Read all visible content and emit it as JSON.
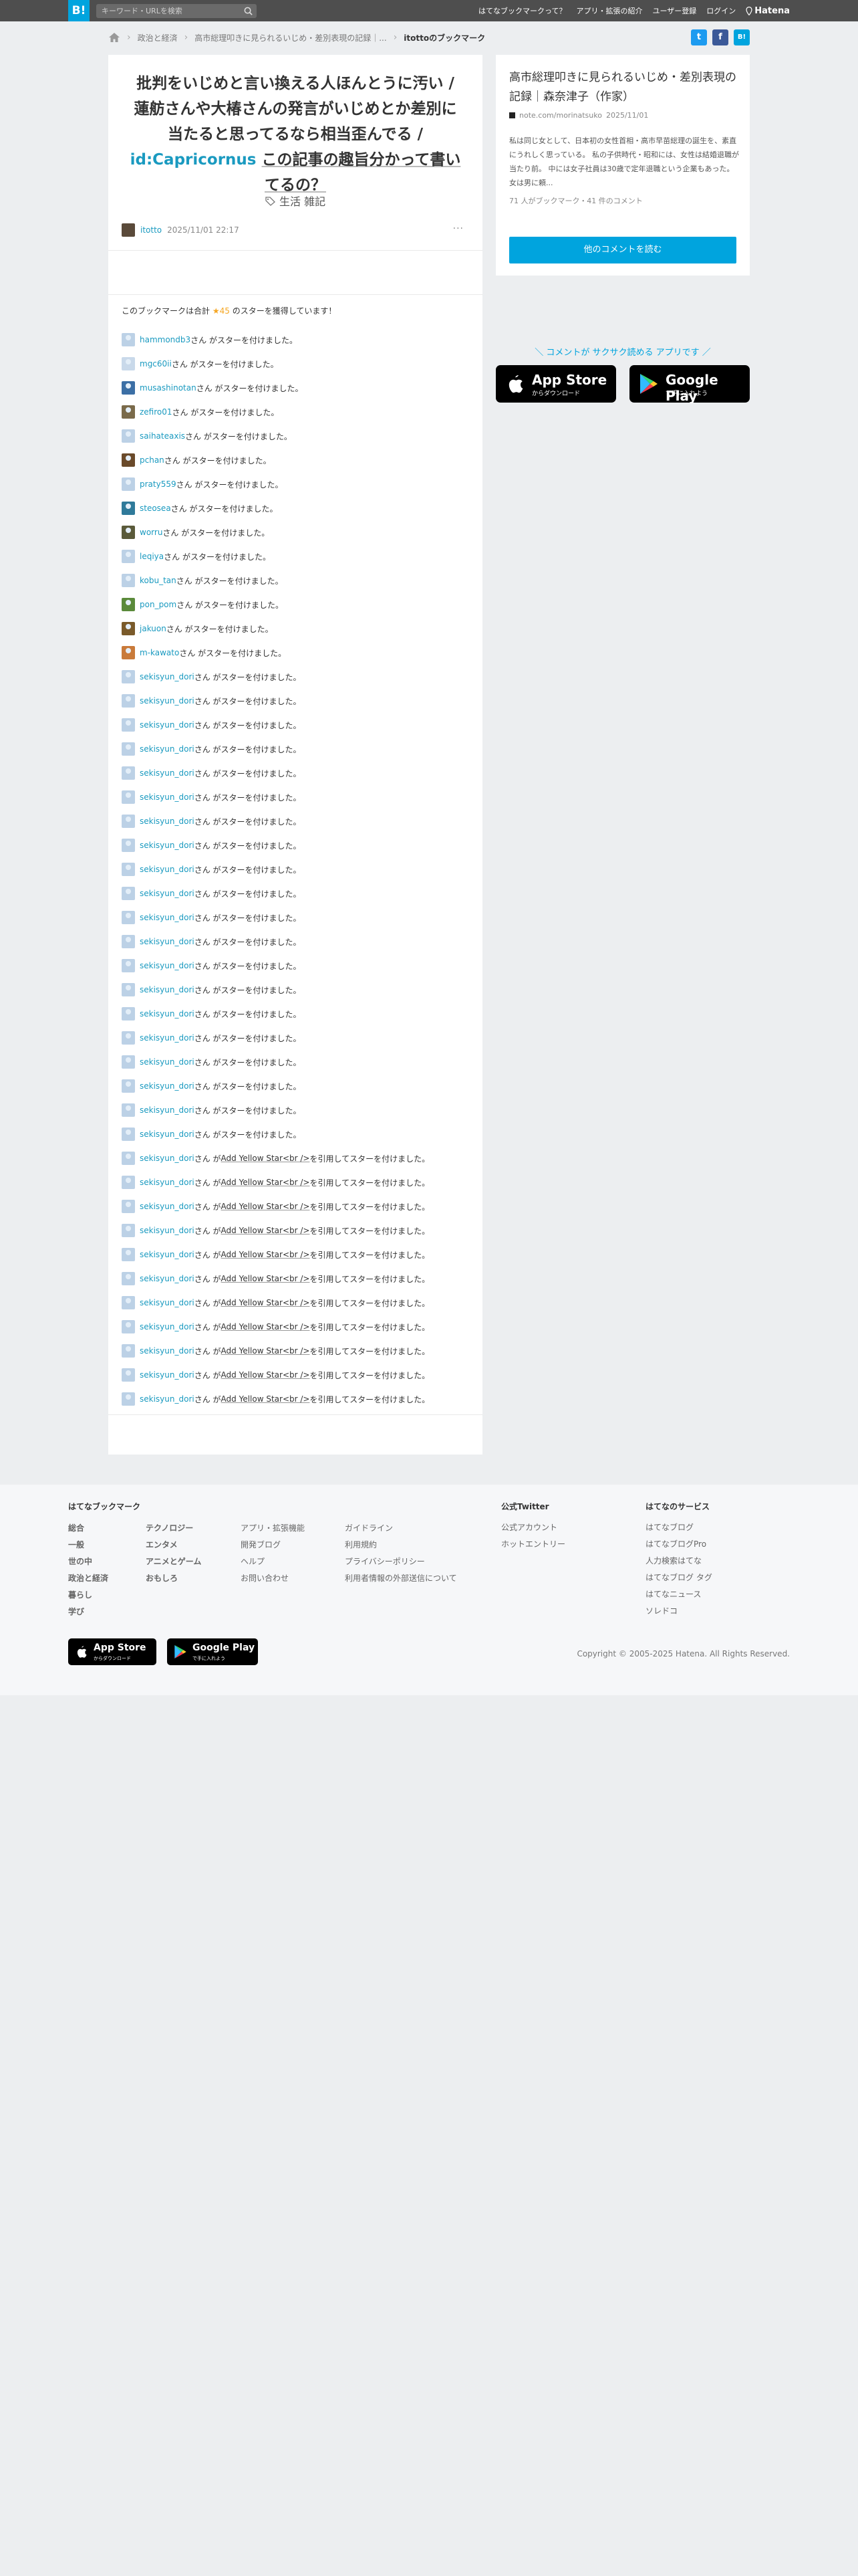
{
  "header": {
    "logo": "B!",
    "search_placeholder": "キーワード・URLを検索",
    "nav": [
      "はてなブックマークって？",
      "アプリ・拡張の紹介",
      "ユーザー登録",
      "ログイン"
    ],
    "brand": "Hatena"
  },
  "breadcrumb": {
    "items": [
      "政治と経済",
      "高市総理叩きに見られるいじめ・差別表現の記録｜..."
    ],
    "current": "itottoのブックマーク"
  },
  "share": {
    "twitter": "t",
    "facebook": "f",
    "hatena": "B!"
  },
  "entry": {
    "title_1": "批判をいじめと言い換える人ほんとうに汚い / 蓮舫さんや大椿さんの発言がいじめとか差別に当たると思ってるなら相当歪んでる / ",
    "title_link": "id:Capricornus",
    "title_2": "この記事の趣旨分かって書いてるの？",
    "tags": [
      "生活",
      "雑記"
    ],
    "user": "itotto",
    "timestamp": "2025/11/01 22:17",
    "more": "···"
  },
  "stars": {
    "summary_pre": "このブックマークは合計",
    "summary_count": "★45",
    "summary_post": "のスターを獲得しています！",
    "list": [
      {
        "name": "hammondb3",
        "text": "さん がスターを付けました。"
      },
      {
        "name": "mgc60ii",
        "text": "さん がスターを付けました。"
      },
      {
        "name": "musashinotan",
        "text": "さん がスターを付けました。"
      },
      {
        "name": "zefiro01",
        "text": "さん がスターを付けました。"
      },
      {
        "name": "saihateaxis",
        "text": "さん がスターを付けました。"
      },
      {
        "name": "pchan",
        "text": "さん がスターを付けました。"
      },
      {
        "name": "praty559",
        "text": "さん がスターを付けました。"
      },
      {
        "name": "steosea",
        "text": "さん がスターを付けました。"
      },
      {
        "name": "worru",
        "text": "さん がスターを付けました。"
      },
      {
        "name": "leqiya",
        "text": "さん がスターを付けました。"
      },
      {
        "name": "kobu_tan",
        "text": "さん がスターを付けました。"
      },
      {
        "name": "pon_pom",
        "text": "さん がスターを付けました。"
      },
      {
        "name": "jakuon",
        "text": "さん がスターを付けました。"
      },
      {
        "name": "m-kawato",
        "text": "さん がスターを付けました。"
      },
      {
        "name": "sekisyun_dori",
        "text": "さん がスターを付けました。"
      },
      {
        "name": "sekisyun_dori",
        "text": "さん がスターを付けました。"
      },
      {
        "name": "sekisyun_dori",
        "text": "さん がスターを付けました。"
      },
      {
        "name": "sekisyun_dori",
        "text": "さん がスターを付けました。"
      },
      {
        "name": "sekisyun_dori",
        "text": "さん がスターを付けました。"
      },
      {
        "name": "sekisyun_dori",
        "text": "さん がスターを付けました。"
      },
      {
        "name": "sekisyun_dori",
        "text": "さん がスターを付けました。"
      },
      {
        "name": "sekisyun_dori",
        "text": "さん がスターを付けました。"
      },
      {
        "name": "sekisyun_dori",
        "text": "さん がスターを付けました。"
      },
      {
        "name": "sekisyun_dori",
        "text": "さん がスターを付けました。"
      },
      {
        "name": "sekisyun_dori",
        "text": "さん がスターを付けました。"
      },
      {
        "name": "sekisyun_dori",
        "text": "さん がスターを付けました。"
      },
      {
        "name": "sekisyun_dori",
        "text": "さん がスターを付けました。"
      },
      {
        "name": "sekisyun_dori",
        "text": "さん がスターを付けました。"
      },
      {
        "name": "sekisyun_dori",
        "text": "さん がスターを付けました。"
      },
      {
        "name": "sekisyun_dori",
        "text": "さん がスターを付けました。"
      },
      {
        "name": "sekisyun_dori",
        "text": "さん がスターを付けました。"
      },
      {
        "name": "sekisyun_dori",
        "text": "さん がスターを付けました。"
      },
      {
        "name": "sekisyun_dori",
        "text": "さん がスターを付けました。"
      },
      {
        "name": "sekisyun_dori",
        "text": "さん がスターを付けました。"
      },
      {
        "name": "sekisyun_dori",
        "text": "さん が ",
        "quote": "Add Yellow Star<br />",
        "post": " を引用してスターを付けました。"
      },
      {
        "name": "sekisyun_dori",
        "text": "さん が ",
        "quote": "Add Yellow Star<br />",
        "post": " を引用してスターを付けました。"
      },
      {
        "name": "sekisyun_dori",
        "text": "さん が ",
        "quote": "Add Yellow Star<br />",
        "post": " を引用してスターを付けました。"
      },
      {
        "name": "sekisyun_dori",
        "text": "さん が ",
        "quote": "Add Yellow Star<br />",
        "post": " を引用してスターを付けました。"
      },
      {
        "name": "sekisyun_dori",
        "text": "さん が ",
        "quote": "Add Yellow Star<br />",
        "post": " を引用してスターを付けました。"
      },
      {
        "name": "sekisyun_dori",
        "text": "さん が ",
        "quote": "Add Yellow Star<br />",
        "post": " を引用してスターを付けました。"
      },
      {
        "name": "sekisyun_dori",
        "text": "さん が ",
        "quote": "Add Yellow Star<br />",
        "post": " を引用してスターを付けました。"
      },
      {
        "name": "sekisyun_dori",
        "text": "さん が ",
        "quote": "Add Yellow Star<br />",
        "post": " を引用してスターを付けました。"
      },
      {
        "name": "sekisyun_dori",
        "text": "さん が ",
        "quote": "Add Yellow Star<br />",
        "post": " を引用してスターを付けました。"
      },
      {
        "name": "sekisyun_dori",
        "text": "さん が ",
        "quote": "Add Yellow Star<br />",
        "post": " を引用してスターを付けました。"
      },
      {
        "name": "sekisyun_dori",
        "text": "さん が ",
        "quote": "Add Yellow Star<br />",
        "post": " を引用してスターを付けました。"
      }
    ]
  },
  "side": {
    "title": "高市総理叩きに見られるいじめ・差別表現の記録｜森奈津子（作家）",
    "domain": "note.com/morinatsuko",
    "date": "2025/11/01",
    "description": "私は同じ女として、日本初の女性首相・高市早苗総理の誕生を、素直にうれしく思っている。 私の子供時代・昭和には、女性は結婚退職が当たり前。 中には女子社員は30歳で定年退職という企業もあった。 女は男に頼...",
    "counts": "71 人がブックマーク・41 件のコメント",
    "button": "他のコメントを読む"
  },
  "app_promo": {
    "caption": "＼ コメントが サクサク読める アプリです ／",
    "appstore_main": "App Store",
    "appstore_sub": "からダウンロード",
    "googleplay_main": "Google Play",
    "googleplay_sub": "で手に入れよう"
  },
  "footer": {
    "col1_title": "はてなブックマーク",
    "categories_a": [
      "総合",
      "一般",
      "世の中",
      "政治と経済",
      "暮らし",
      "学び"
    ],
    "categories_b": [
      "テクノロジー",
      "エンタメ",
      "アニメとゲーム",
      "おもしろ"
    ],
    "links_a": [
      "アプリ・拡張機能",
      "開発ブログ",
      "ヘルプ",
      "お問い合わせ"
    ],
    "links_b": [
      "ガイドライン",
      "利用規約",
      "プライバシーポリシー",
      "利用者情報の外部送信について"
    ],
    "twitter_title": "公式Twitter",
    "twitter_links": [
      "公式アカウント",
      "ホットエントリー"
    ],
    "services_title": "はてなのサービス",
    "services": [
      "はてなブログ",
      "はてなブログPro",
      "人力検索はてな",
      "はてなブログ タグ",
      "はてなニュース",
      "ソレドコ"
    ],
    "copyright": "Copyright © 2005-2025 Hatena. All Rights Reserved."
  },
  "colors": {
    "accent": "#00a4de",
    "header": "#4e4e4e",
    "link": "#1a9ac0",
    "star": "#f5a623"
  }
}
